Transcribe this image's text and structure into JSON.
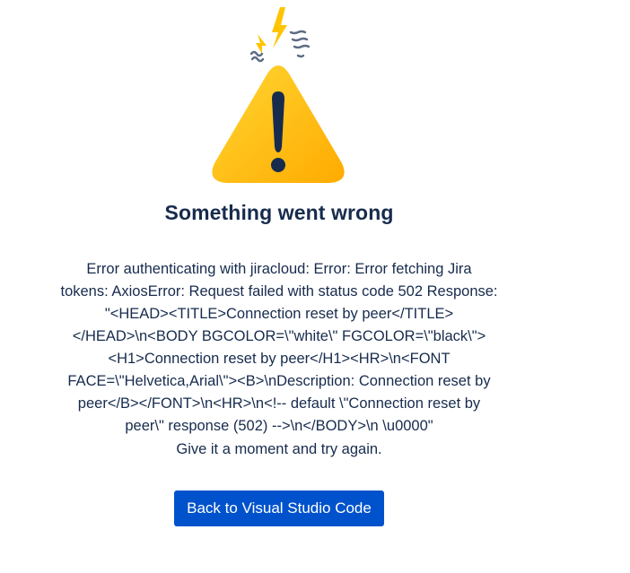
{
  "error": {
    "title": "Something went wrong",
    "message": "Error authenticating with jiracloud: Error: Error fetching Jira\ntokens: AxiosError: Request failed with status code 502 Response:\n\"<HEAD><TITLE>Connection reset by peer</TITLE>\n</HEAD>\\n<BODY BGCOLOR=\\\"white\\\" FGCOLOR=\\\"black\\\">\n<H1>Connection reset by peer</H1><HR>\\n<FONT\nFACE=\\\"Helvetica,Arial\\\"><B>\\nDescription: Connection reset by\npeer</B></FONT>\\n<HR>\\n<!-- default \\\"Connection reset by\npeer\\\" response (502) -->\\n</BODY>\\n \\u0000\"",
    "hint": "Give it a moment and try again."
  },
  "actions": {
    "back_label": "Back to Visual Studio Code"
  },
  "icons": {
    "illustration": "warning-triangle-icon"
  },
  "colors": {
    "primary_button": "#0052cc",
    "text": "#172b4d",
    "warning": "#ffc400"
  }
}
